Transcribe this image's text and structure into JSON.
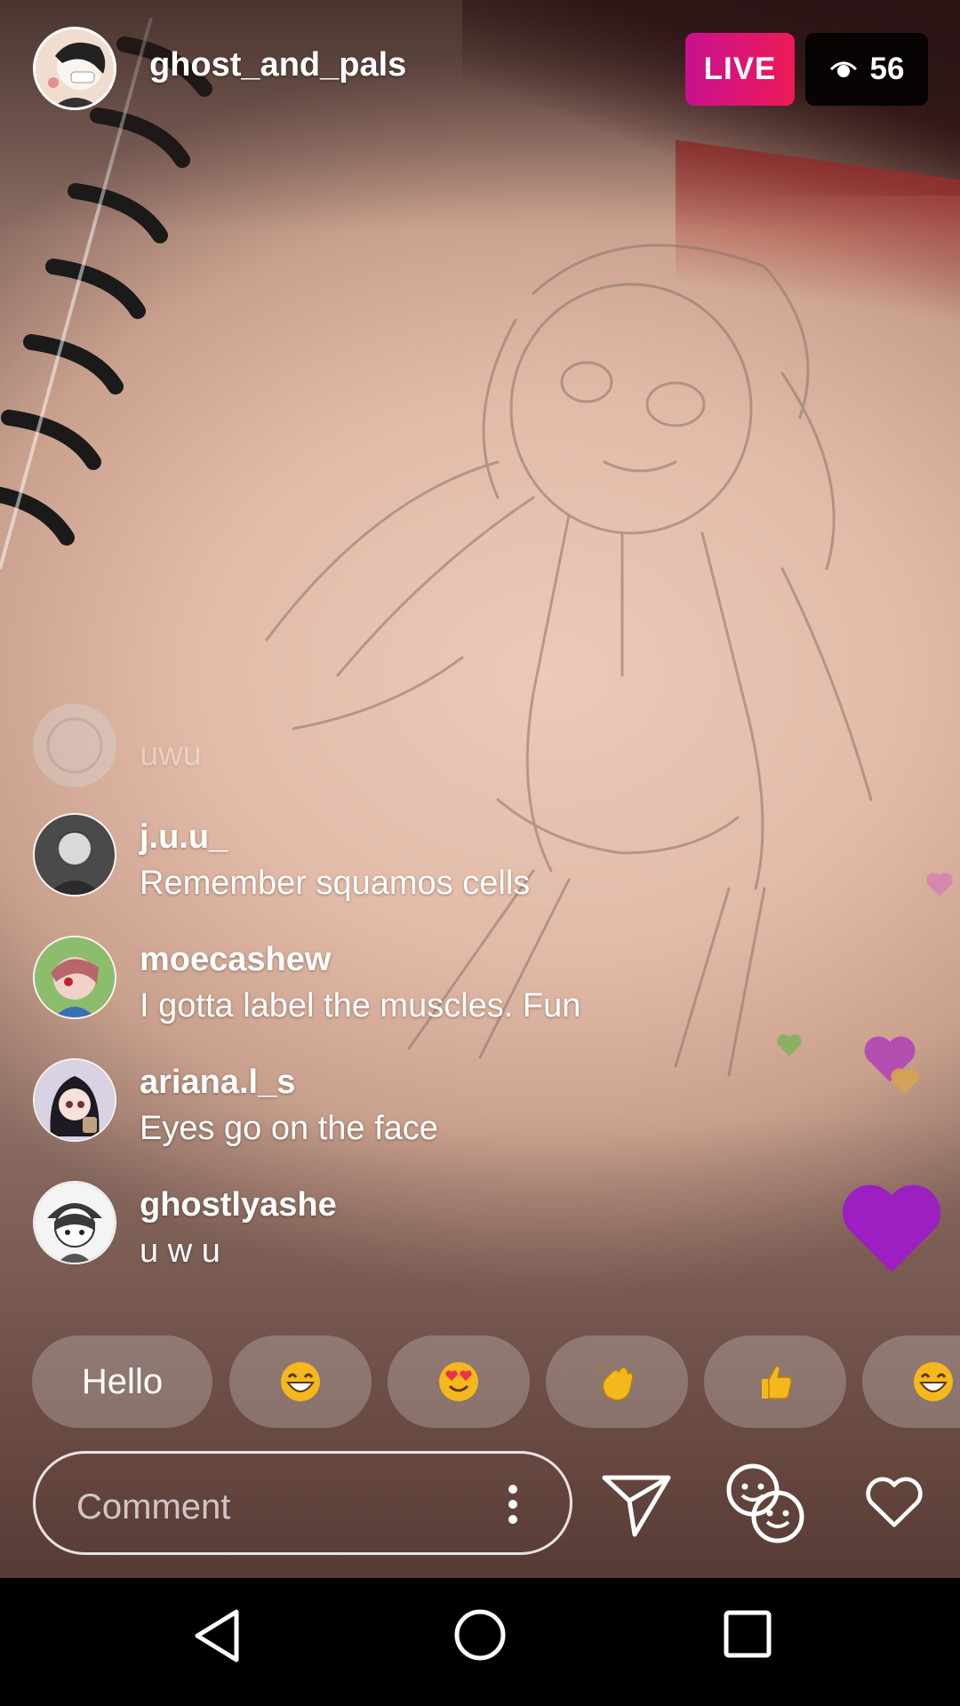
{
  "header": {
    "host_username": "ghost_and_pals",
    "live_label": "LIVE",
    "viewer_count": "56"
  },
  "comments": [
    {
      "username": "",
      "message": "uwu",
      "faded": true
    },
    {
      "username": "j.u.u_",
      "message": "Remember squamos cells"
    },
    {
      "username": "moecashew",
      "message": "I gotta label the muscles. Fun"
    },
    {
      "username": "ariana.l_s",
      "message": "Eyes go on the face"
    },
    {
      "username": "ghostlyashe",
      "message": "u w u"
    }
  ],
  "quick_replies": [
    {
      "label": "Hello"
    },
    {
      "icon": "grinning-face-icon"
    },
    {
      "icon": "heart-eyes-face-icon"
    },
    {
      "icon": "waving-hand-icon"
    },
    {
      "icon": "thumbs-up-icon"
    },
    {
      "icon": "grinning-face-icon"
    }
  ],
  "composer": {
    "placeholder": "Comment"
  },
  "colors": {
    "live_gradient_start": "#c8108f",
    "live_gradient_end": "#ee1a58",
    "big_heart": "#9d1fc2",
    "heart_pink": "#d580b2",
    "heart_green": "#7fb05a",
    "heart_gold": "#d7a250"
  }
}
